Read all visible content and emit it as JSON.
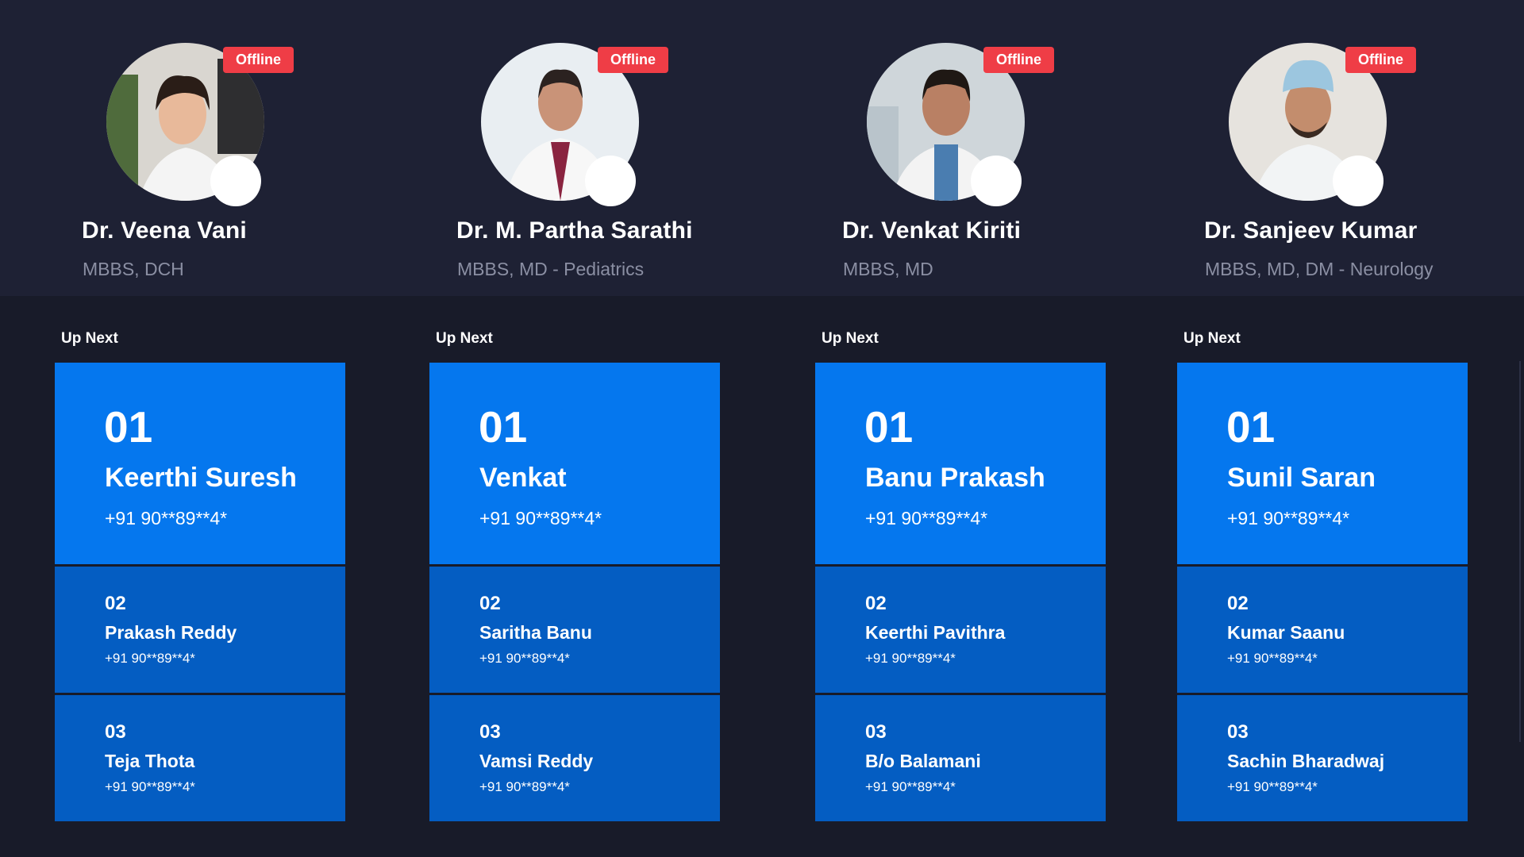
{
  "doctors": [
    {
      "name": "Dr. Veena Vani",
      "qualification": "MBBS, DCH",
      "status": "Offline",
      "up_next_label": "Up Next",
      "queue": [
        {
          "number": "01",
          "name": "Keerthi Suresh",
          "phone": "+91 90**89**4*"
        },
        {
          "number": "02",
          "name": "Prakash Reddy",
          "phone": "+91 90**89**4*"
        },
        {
          "number": "03",
          "name": "Teja Thota",
          "phone": "+91 90**89**4*"
        }
      ]
    },
    {
      "name": "Dr. M. Partha Sarathi",
      "qualification": "MBBS, MD - Pediatrics",
      "status": "Offline",
      "up_next_label": "Up Next",
      "queue": [
        {
          "number": "01",
          "name": "Venkat",
          "phone": "+91 90**89**4*"
        },
        {
          "number": "02",
          "name": "Saritha Banu",
          "phone": "+91 90**89**4*"
        },
        {
          "number": "03",
          "name": "Vamsi Reddy",
          "phone": "+91 90**89**4*"
        }
      ]
    },
    {
      "name": "Dr. Venkat Kiriti",
      "qualification": "MBBS, MD",
      "status": "Offline",
      "up_next_label": "Up Next",
      "queue": [
        {
          "number": "01",
          "name": "Banu Prakash",
          "phone": "+91 90**89**4*"
        },
        {
          "number": "02",
          "name": "Keerthi Pavithra",
          "phone": "+91 90**89**4*"
        },
        {
          "number": "03",
          "name": "B/o Balamani",
          "phone": "+91 90**89**4*"
        }
      ]
    },
    {
      "name": "Dr. Sanjeev Kumar",
      "qualification": "MBBS, MD, DM - Neurology",
      "status": "Offline",
      "up_next_label": "Up Next",
      "queue": [
        {
          "number": "01",
          "name": "Sunil Saran",
          "phone": "+91 90**89**4*"
        },
        {
          "number": "02",
          "name": "Kumar Saanu",
          "phone": "+91 90**89**4*"
        },
        {
          "number": "03",
          "name": "Sachin Bharadwaj",
          "phone": "+91 90**89**4*"
        }
      ]
    }
  ],
  "colors": {
    "background": "#181b29",
    "header_band": "#1e2134",
    "card_primary": "#0577ee",
    "card_secondary": "#045dc2",
    "badge_offline": "#ef3d46",
    "qualification_text": "#8b8fa3"
  }
}
